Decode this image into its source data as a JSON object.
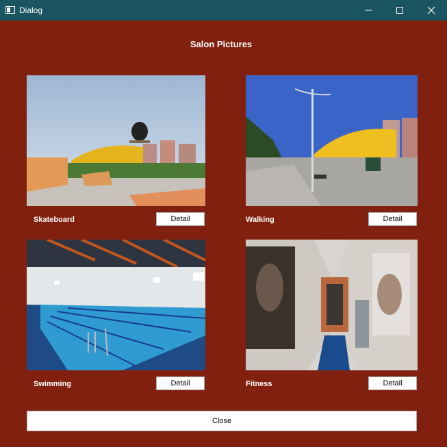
{
  "window": {
    "title": "Dialog"
  },
  "dialog": {
    "heading": "Salon Pictures"
  },
  "cards": [
    {
      "label": "Skateboard",
      "button": "Detail"
    },
    {
      "label": "Walking",
      "button": "Detail"
    },
    {
      "label": "Swimming",
      "button": "Detail"
    },
    {
      "label": "Fitness",
      "button": "Detail"
    }
  ],
  "footer": {
    "close_label": "Close"
  },
  "colors": {
    "background": "#82200f",
    "titlebar": "#1b5561",
    "text": "#ffffff"
  }
}
